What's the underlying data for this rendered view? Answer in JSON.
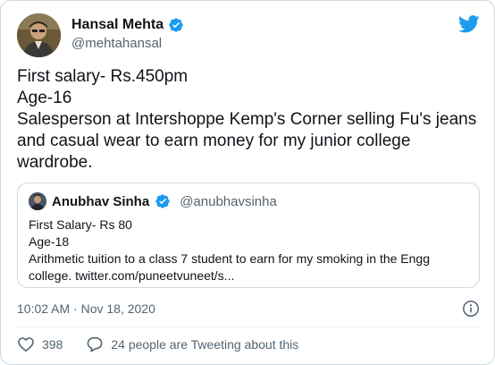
{
  "author": {
    "name": "Hansal Mehta",
    "handle": "@mehtahansal"
  },
  "tweet": {
    "lines": [
      "First salary- Rs.450pm",
      "Age-16",
      "Salesperson at Intershoppe Kemp's Corner selling Fu's jeans",
      "and casual wear to earn money for my junior college",
      "wardrobe."
    ]
  },
  "quoted": {
    "name": "Anubhav Sinha",
    "handle": "@anubhavsinha",
    "lines": [
      "First Salary- Rs 80",
      "Age-18",
      "Arithmetic tuition to a class 7 student to earn for my smoking in the Engg",
      "college. twitter.com/puneetvuneet/s..."
    ]
  },
  "timestamp": "10:02 AM · Nov 18, 2020",
  "actions": {
    "likes": "398",
    "tweeting": "24 people are Tweeting about this"
  },
  "colors": {
    "brand": "#1d9bf0",
    "text": "#0f1419",
    "muted": "#536471",
    "border": "#cfd9de"
  },
  "icons": {
    "verified": "verified-badge-icon",
    "logo": "twitter-bird-icon",
    "info": "info-icon",
    "like": "heart-icon",
    "reply": "speech-bubble-icon"
  }
}
